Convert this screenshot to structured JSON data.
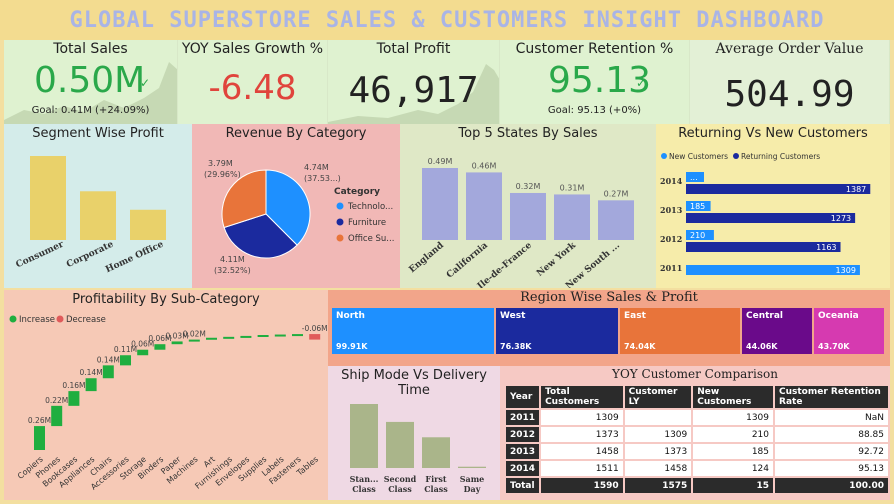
{
  "title": "GLOBAL SUPERSTORE SALES & CUSTOMERS INSIGHT DASHBOARD",
  "kpis": {
    "total_sales": {
      "title": "Total Sales",
      "value": "0.50M",
      "goal": "Goal: 0.41M (+24.09%)",
      "color": "#2aa84a"
    },
    "yoy_growth": {
      "title": "YOY Sales Growth %",
      "value": "-6.48",
      "color": "#e0443c"
    },
    "total_profit": {
      "title": "Total Profit",
      "value": "46,917",
      "color": "#222222"
    },
    "retention": {
      "title": "Customer Retention %",
      "value": "95.13",
      "goal": "Goal: 95.13 (+0%)",
      "color": "#2aa84a"
    },
    "aov": {
      "title": "Average Order Value",
      "value": "504.99",
      "color": "#222222"
    }
  },
  "chart_data": [
    {
      "id": "segment",
      "type": "bar",
      "title": "Segment Wise Profit",
      "categories": [
        "Consumer",
        "Corporate",
        "Home Office"
      ],
      "values": [
        100,
        58,
        36
      ],
      "color": "#e9d16a"
    },
    {
      "id": "category",
      "type": "pie",
      "title": "Revenue By Category",
      "legend_title": "Category",
      "slices": [
        {
          "name": "Technolo...",
          "value": 37.53,
          "label": "4.74M (37.53...)",
          "color": "#1e90ff"
        },
        {
          "name": "Furniture",
          "value": 32.52,
          "label": "4.11M (32.52%)",
          "color": "#1b2a9e"
        },
        {
          "name": "Office Su...",
          "value": 29.96,
          "label": "3.79M (29.96%)",
          "color": "#e8743a"
        }
      ]
    },
    {
      "id": "states",
      "type": "bar",
      "title": "Top 5 States By Sales",
      "categories": [
        "England",
        "California",
        "Ile-de-France",
        "New York",
        "New South ..."
      ],
      "values": [
        0.49,
        0.46,
        0.32,
        0.31,
        0.27
      ],
      "labels": [
        "0.49M",
        "0.46M",
        "0.32M",
        "0.31M",
        "0.27M"
      ],
      "color": "#a3a8dc"
    },
    {
      "id": "returning",
      "type": "bar",
      "title": "Returning Vs New Customers",
      "legend": [
        "New Customers",
        "Returning Customers"
      ],
      "categories": [
        "2014",
        "2013",
        "2012",
        "2011"
      ],
      "series": [
        {
          "name": "New Customers",
          "values": [
            124,
            185,
            210,
            1309
          ],
          "labels": [
            "...",
            "185",
            "210",
            "1309"
          ],
          "color": "#1e90ff"
        },
        {
          "name": "Returning Customers",
          "values": [
            1387,
            1273,
            1163,
            0
          ],
          "labels": [
            "1387",
            "1273",
            "1163",
            ""
          ],
          "color": "#1b2a9e"
        }
      ]
    },
    {
      "id": "subcategory",
      "type": "bar",
      "title": "Profitability By Sub-Category",
      "legend": [
        "Increase",
        "Decrease"
      ],
      "categories": [
        "Copiers",
        "Phones",
        "Bookcases",
        "Appliances",
        "Chairs",
        "Accessories",
        "Storage",
        "Binders",
        "Paper",
        "Machines",
        "Art",
        "Furnishings",
        "Envelopes",
        "Supplies",
        "Labels",
        "Fasteners",
        "Tables"
      ],
      "values": [
        0.26,
        0.22,
        0.16,
        0.14,
        0.14,
        0.11,
        0.06,
        0.06,
        0.03,
        0.02,
        0.02,
        0.01,
        0.01,
        0.01,
        0.005,
        0.005,
        -0.06
      ],
      "labels": [
        "0.26M",
        "0.22M",
        "0.16M",
        "0.14M",
        "0.14M",
        "0.11M",
        "0.06M",
        "0.06M",
        "0.03M",
        "0.02M",
        "",
        "",
        "",
        "",
        "",
        "",
        "-0.06M"
      ],
      "colors": {
        "increase": "#1fae3f",
        "decrease": "#e05a5a"
      }
    },
    {
      "id": "region",
      "type": "table",
      "title": "Region Wise Sales & Profit",
      "cells": [
        {
          "name": "North",
          "value": "99.91K",
          "color": "#1e90ff"
        },
        {
          "name": "West",
          "value": "76.38K",
          "color": "#1b2a9e"
        },
        {
          "name": "East",
          "value": "74.04K",
          "color": "#e8743a"
        },
        {
          "name": "Central",
          "value": "44.06K",
          "color": "#6a0a8a"
        },
        {
          "name": "Oceania",
          "value": "43.70K",
          "color": "#d63ab0"
        }
      ]
    },
    {
      "id": "shipmode",
      "type": "bar",
      "title": "Ship Mode Vs Delivery Time",
      "categories": [
        "Stan... Class",
        "Second Class",
        "First Class",
        "Same Day"
      ],
      "values": [
        100,
        72,
        48,
        2
      ],
      "color": "#aab58a"
    }
  ],
  "yoy_table": {
    "title": "YOY Customer Comparison",
    "columns": [
      "Year",
      "Total Customers",
      "Customer LY",
      "New Customers",
      "Customer Retention Rate"
    ],
    "rows": [
      [
        "2011",
        "1309",
        "",
        "1309",
        "NaN"
      ],
      [
        "2012",
        "1373",
        "1309",
        "210",
        "88.85"
      ],
      [
        "2013",
        "1458",
        "1373",
        "185",
        "92.72"
      ],
      [
        "2014",
        "1511",
        "1458",
        "124",
        "95.13"
      ]
    ],
    "total": [
      "Total",
      "1590",
      "1575",
      "15",
      "100.00"
    ]
  }
}
